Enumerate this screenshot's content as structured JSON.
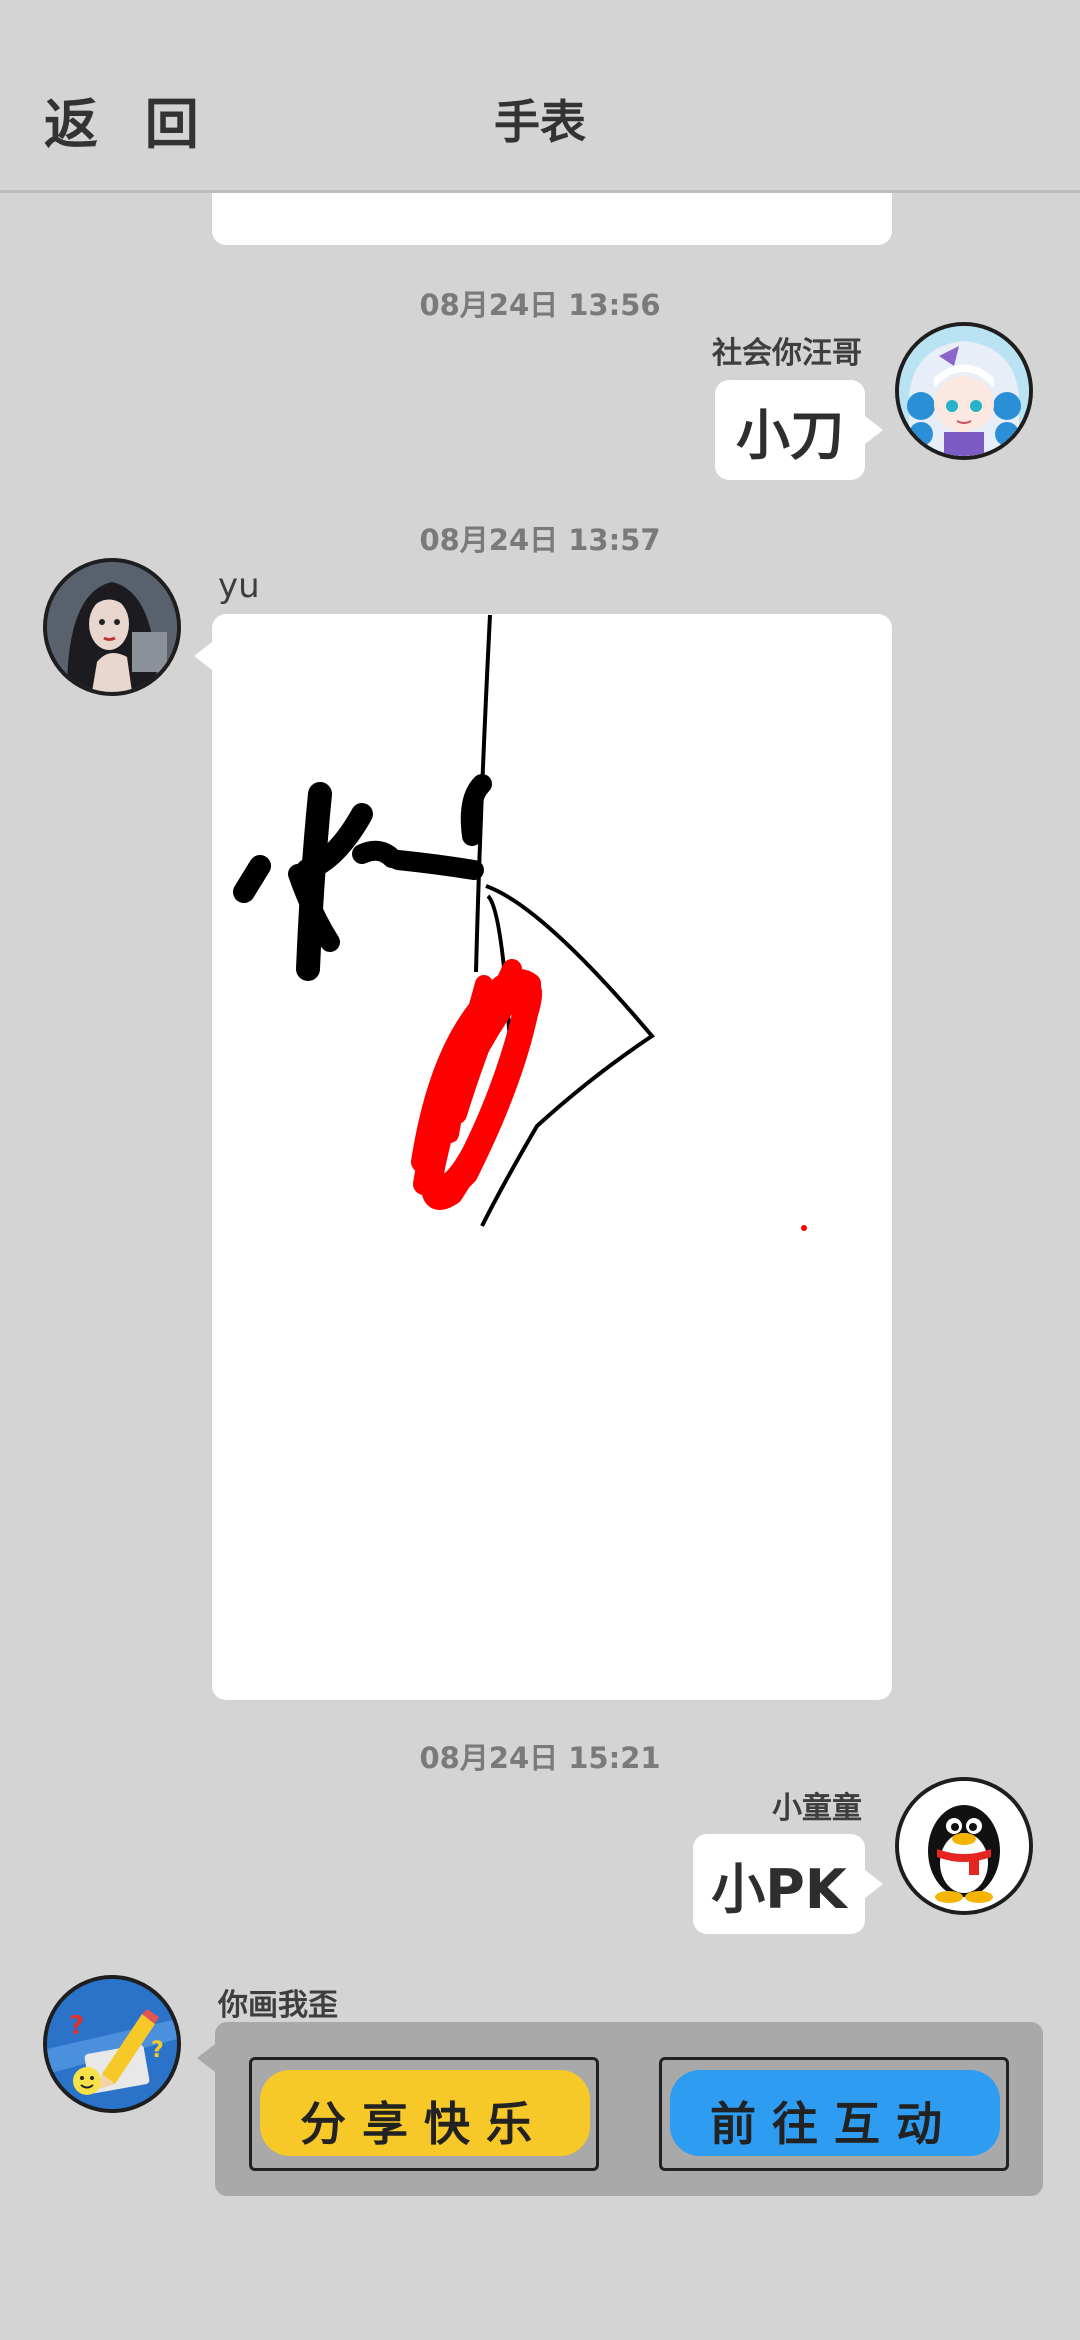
{
  "header": {
    "back_label": "返 回",
    "title": "手表"
  },
  "messages": [
    {
      "time": "08月24日  13:56",
      "sender": "社会你汪哥",
      "text": "小刀",
      "side": "right"
    },
    {
      "time": "08月24日  13:57",
      "sender": "yu",
      "side": "left",
      "content": "drawing"
    },
    {
      "time": "08月24日  15:21",
      "sender": "小童童",
      "text": "小PK",
      "side": "right"
    },
    {
      "sender": "你画我歪",
      "side": "left",
      "content": "actions"
    }
  ],
  "actions": {
    "share_label": "分享快乐",
    "interact_label": "前往互动"
  },
  "colors": {
    "share": "#f7c928",
    "interact": "#2e9cf0",
    "stroke_red": "#ff0000",
    "background": "#d4d4d4"
  }
}
